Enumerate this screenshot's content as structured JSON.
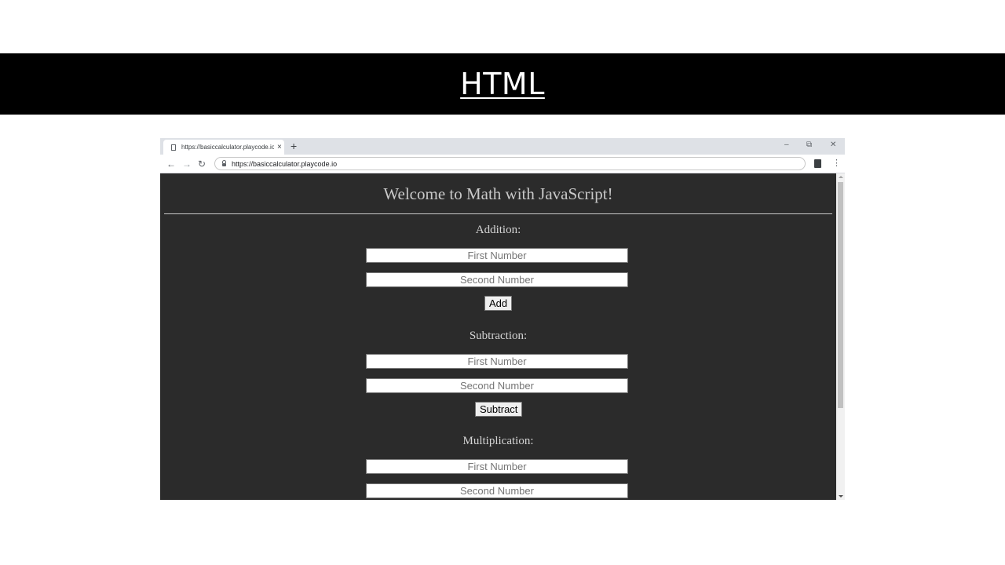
{
  "slide": {
    "title": "HTML"
  },
  "browser": {
    "tab_title": "https://basiccalculator.playcode.io/",
    "tab_close": "×",
    "new_tab": "+",
    "minimize": "–",
    "restore": "⧉",
    "close": "✕",
    "back": "←",
    "forward": "→",
    "reload": "↻",
    "url": "https://basiccalculator.playcode.io",
    "menu": "⋮"
  },
  "page": {
    "heading": "Welcome to Math with JavaScript!",
    "addition": {
      "label": "Addition:",
      "first_placeholder": "First Number",
      "second_placeholder": "Second Number",
      "button": "Add"
    },
    "subtraction": {
      "label": "Subtraction:",
      "first_placeholder": "First Number",
      "second_placeholder": "Second Number",
      "button": "Subtract"
    },
    "multiplication": {
      "label": "Multiplication:",
      "first_placeholder": "First Number",
      "second_placeholder": "Second Number"
    }
  },
  "colors": {
    "page_background": "#2b2b2b",
    "banner_background": "#000000",
    "heading_text": "#c9c9c9"
  }
}
